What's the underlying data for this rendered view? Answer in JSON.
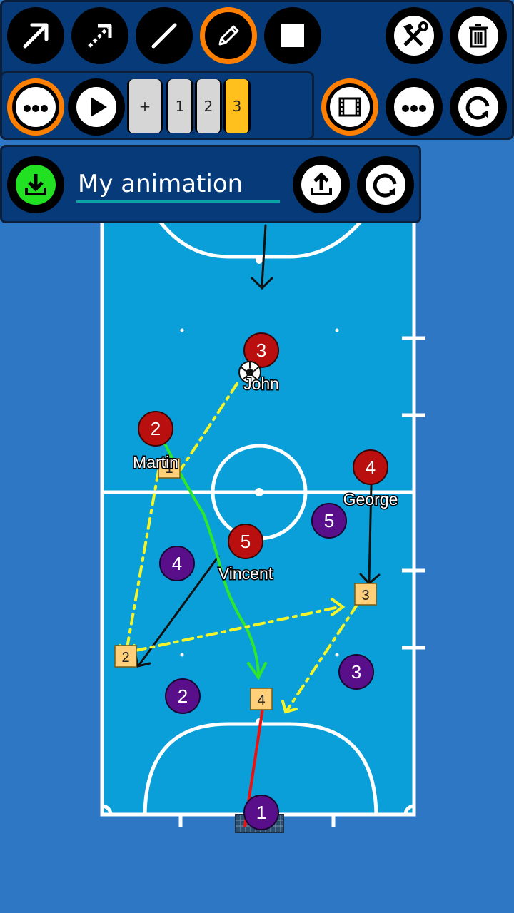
{
  "toolbar": {
    "tools": [
      "arrow-tool",
      "dashed-arrow-tool",
      "line-tool",
      "pencil-tool",
      "stop-tool"
    ],
    "selected_tool": "pencil-tool",
    "right_tools": [
      "hammer-wrench-icon",
      "trash-icon"
    ]
  },
  "frames": {
    "add_label": "+",
    "items": [
      "1",
      "2",
      "3"
    ],
    "active": "3"
  },
  "animation": {
    "name": "My animation"
  },
  "court": {
    "colors": {
      "floor": "#0a9fd8",
      "lines": "#ffffff",
      "red_team": "#b90f0f",
      "purple_team": "#5a0f8a",
      "marker": "#ffcf7a"
    },
    "red_players": [
      {
        "number": "3",
        "name": "John"
      },
      {
        "number": "2",
        "name": "Martin"
      },
      {
        "number": "4",
        "name": "George"
      },
      {
        "number": "5",
        "name": "Vincent"
      }
    ],
    "purple_players": [
      "5",
      "4",
      "3",
      "2",
      "1"
    ],
    "markers": [
      "1",
      "2",
      "3",
      "4"
    ]
  }
}
